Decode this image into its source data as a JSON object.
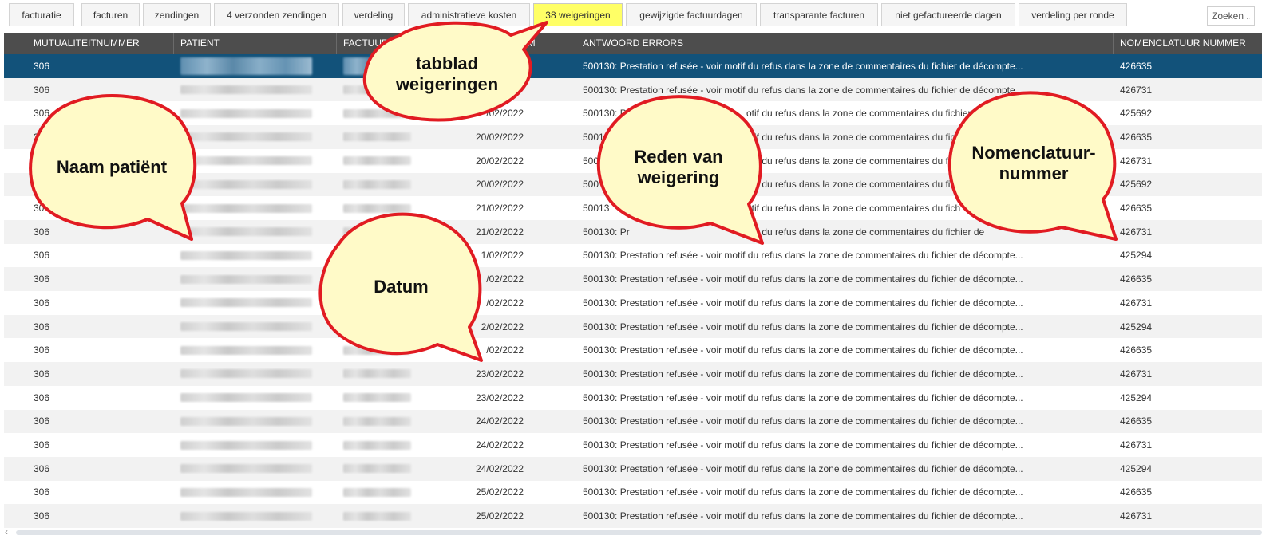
{
  "tabs": [
    {
      "label": "facturatie",
      "active": false
    },
    {
      "label": "facturen",
      "active": false
    },
    {
      "label": "zendingen",
      "active": false
    },
    {
      "label": "4 verzonden zendingen",
      "active": false
    },
    {
      "label": "verdeling",
      "active": false
    },
    {
      "label": "administratieve kosten",
      "active": false
    },
    {
      "label": "38 weigeringen",
      "active": true
    },
    {
      "label": "gewijzigde factuurdagen",
      "active": false
    },
    {
      "label": "transparante facturen",
      "active": false
    },
    {
      "label": "niet gefactureerde dagen",
      "active": false
    },
    {
      "label": "verdeling per ronde",
      "active": false
    }
  ],
  "search": {
    "placeholder": "Zoeken ..."
  },
  "columns": [
    "MUTUALITEITNUMMER",
    "PATIENT",
    "FACTUUR",
    "UM",
    "ANTWOORD ERRORS",
    "NOMENCLATUUR NUMMER"
  ],
  "rows": [
    {
      "mutualiteit": "306",
      "datum": "",
      "error": "500130: Prestation refusée - voir motif du refus dans la zone de commentaires du fichier de décompte...",
      "nomenclatuur": "426635",
      "selected": true
    },
    {
      "mutualiteit": "306",
      "datum": "",
      "error": "500130: Prestation refusée - voir motif du refus dans la zone de commentaires du fichier de décompte...",
      "nomenclatuur": "426731"
    },
    {
      "mutualiteit": "306",
      "datum": "/02/2022",
      "error": "500130: Pr",
      "error2": "otif du refus dans la zone de commentaires du fichier",
      "nomenclatuur": "425692"
    },
    {
      "mutualiteit": "3",
      "datum": "20/02/2022",
      "error": "50013",
      "error2": "otif du refus dans la zone de commentaires du fich",
      "nomenclatuur": "426635"
    },
    {
      "mutualiteit": "",
      "datum": "20/02/2022",
      "error": "500",
      "error2": "otif du refus dans la zone de commentaires du fich",
      "nomenclatuur": "426731"
    },
    {
      "mutualiteit": "",
      "datum": "20/02/2022",
      "error": "500",
      "error2": "otif du refus dans la zone de commentaires du fich",
      "nomenclatuur": "425692"
    },
    {
      "mutualiteit": "30",
      "datum": "21/02/2022",
      "error": "50013",
      "error2": "otif du refus dans la zone de commentaires du fich",
      "nomenclatuur": "426635"
    },
    {
      "mutualiteit": "306",
      "datum": "21/02/2022",
      "error": "500130: Pr",
      "error2": "otif du refus dans la zone de commentaires du fichier de",
      "nomenclatuur": "426731"
    },
    {
      "mutualiteit": "306",
      "datum": "1/02/2022",
      "error": "500130: Prestation refusée - voir motif du refus dans la zone de commentaires du fichier de décompte...",
      "nomenclatuur": "425294"
    },
    {
      "mutualiteit": "306",
      "datum": "/02/2022",
      "error": "500130: Prestation refusée - voir motif du refus dans la zone de commentaires du fichier de décompte...",
      "nomenclatuur": "426635"
    },
    {
      "mutualiteit": "306",
      "datum": "/02/2022",
      "error": "500130: Prestation refusée - voir motif du refus dans la zone de commentaires du fichier de décompte...",
      "nomenclatuur": "426731"
    },
    {
      "mutualiteit": "306",
      "datum": "2/02/2022",
      "error": "500130: Prestation refusée - voir motif du refus dans la zone de commentaires du fichier de décompte...",
      "nomenclatuur": "425294"
    },
    {
      "mutualiteit": "306",
      "datum": "/02/2022",
      "error": "500130: Prestation refusée - voir motif du refus dans la zone de commentaires du fichier de décompte...",
      "nomenclatuur": "426635"
    },
    {
      "mutualiteit": "306",
      "datum": "23/02/2022",
      "error": "500130: Prestation refusée - voir motif du refus dans la zone de commentaires du fichier de décompte...",
      "nomenclatuur": "426731"
    },
    {
      "mutualiteit": "306",
      "datum": "23/02/2022",
      "error": "500130: Prestation refusée - voir motif du refus dans la zone de commentaires du fichier de décompte...",
      "nomenclatuur": "425294"
    },
    {
      "mutualiteit": "306",
      "datum": "24/02/2022",
      "error": "500130: Prestation refusée - voir motif du refus dans la zone de commentaires du fichier de décompte...",
      "nomenclatuur": "426635"
    },
    {
      "mutualiteit": "306",
      "datum": "24/02/2022",
      "error": "500130: Prestation refusée - voir motif du refus dans la zone de commentaires du fichier de décompte...",
      "nomenclatuur": "426731"
    },
    {
      "mutualiteit": "306",
      "datum": "24/02/2022",
      "error": "500130: Prestation refusée - voir motif du refus dans la zone de commentaires du fichier de décompte...",
      "nomenclatuur": "425294"
    },
    {
      "mutualiteit": "306",
      "datum": "25/02/2022",
      "error": "500130: Prestation refusée - voir motif du refus dans la zone de commentaires du fichier de décompte...",
      "nomenclatuur": "426635"
    },
    {
      "mutualiteit": "306",
      "datum": "25/02/2022",
      "error": "500130: Prestation refusée - voir motif du refus dans la zone de commentaires du fichier de décompte...",
      "nomenclatuur": "426731"
    }
  ],
  "callouts": [
    {
      "id": "tabblad",
      "text": "tabblad weigeringen"
    },
    {
      "id": "naam",
      "text": "Naam patiënt"
    },
    {
      "id": "datum",
      "text": "Datum"
    },
    {
      "id": "reden",
      "text": "Reden van weigering"
    },
    {
      "id": "nomenclatuur",
      "text": "Nomenclatuur-nummer"
    }
  ],
  "colors": {
    "header_bg": "#4d4d4d",
    "selected_row_bg": "#12527a",
    "active_tab_bg": "#ffff66",
    "callout_fill": "#fffac8",
    "callout_stroke": "#e11b22"
  }
}
